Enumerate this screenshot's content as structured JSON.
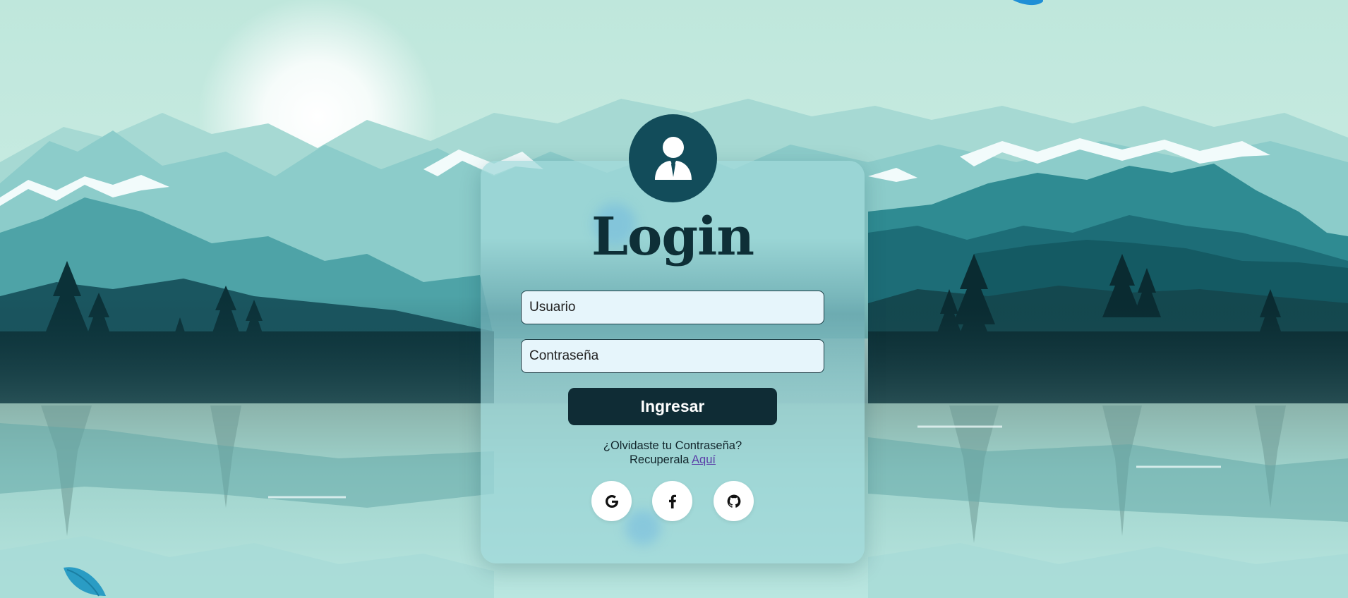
{
  "page": {
    "title": "Login"
  },
  "form": {
    "heading": "Login",
    "username": {
      "placeholder": "Usuario",
      "value": ""
    },
    "password": {
      "placeholder": "Contraseña",
      "value": ""
    },
    "submit_label": "Ingresar"
  },
  "forgot": {
    "line1": "¿Olvidaste tu Contraseña?",
    "line2_prefix": "Recuperala ",
    "link_label": "Aquí"
  },
  "social": [
    {
      "name": "google",
      "icon": "google-icon"
    },
    {
      "name": "facebook",
      "icon": "facebook-icon"
    },
    {
      "name": "github",
      "icon": "github-icon"
    }
  ],
  "colors": {
    "sky": "#c6ebe2",
    "button_dark": "#0f2c35",
    "avatar_bg": "#124c5a",
    "link": "#5b3fa8",
    "input_bg": "#e6f5fb"
  }
}
